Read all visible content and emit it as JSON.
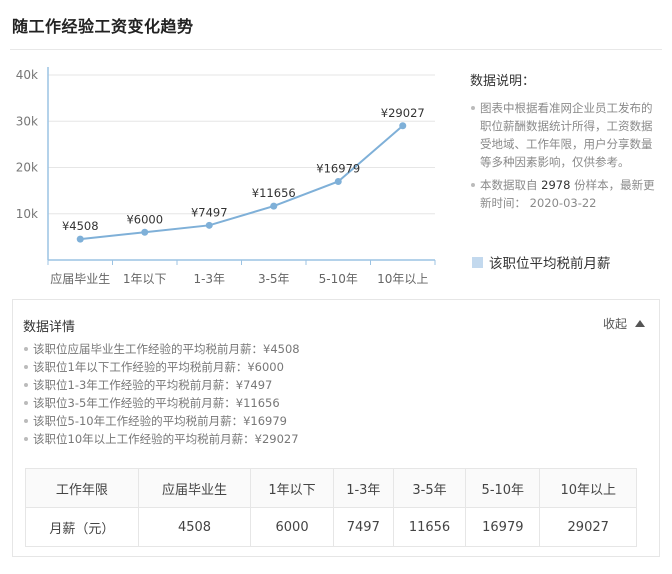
{
  "title": "随工作经验工资变化趋势",
  "chart_data": {
    "type": "line",
    "categories": [
      "应届毕业生",
      "1年以下",
      "1-3年",
      "3-5年",
      "5-10年",
      "10年以上"
    ],
    "series": [
      {
        "name": "该职位平均税前月薪",
        "values": [
          4508,
          6000,
          7497,
          11656,
          16979,
          29027
        ]
      }
    ],
    "data_labels": [
      "¥4508",
      "¥6000",
      "¥7497",
      "¥11656",
      "¥16979",
      "¥29027"
    ],
    "y_ticks": [
      "10k",
      "20k",
      "30k",
      "40k"
    ],
    "ylim": [
      0,
      40000
    ],
    "grid": "horizontal",
    "line_color": "#7fb0d8"
  },
  "legend": {
    "heading": "数据说明：",
    "notes": [
      "图表中根据看准网企业员工发布的职位薪酬数据统计所得，工资数据受地域、工作年限，用户分享数量等多种因素影响，仅供参考。",
      {
        "before": "本数据取自 ",
        "count": "2978",
        "after": " 份样本，最新更新时间： 2020-03-22"
      }
    ],
    "series_label": "该职位平均税前月薪"
  },
  "detail": {
    "heading": "数据详情",
    "collapse_label": "收起",
    "items": [
      "该职位应届毕业生工作经验的平均税前月薪：¥4508",
      "该职位1年以下工作经验的平均税前月薪：¥6000",
      "该职位1-3年工作经验的平均税前月薪：¥7497",
      "该职位3-5年工作经验的平均税前月薪：¥11656",
      "该职位5-10年工作经验的平均税前月薪：¥16979",
      "该职位10年以上工作经验的平均税前月薪：¥29027"
    ],
    "table": {
      "header": [
        "工作年限",
        "应届毕业生",
        "1年以下",
        "1-3年",
        "3-5年",
        "5-10年",
        "10年以上"
      ],
      "row": [
        "月薪（元）",
        "4508",
        "6000",
        "7497",
        "11656",
        "16979",
        "29027"
      ]
    }
  },
  "colors": {
    "line": "#7fb0d8",
    "grid": "#e6e6e6",
    "axis": "#9cc3e3",
    "swatch": "#c3d9ee"
  }
}
